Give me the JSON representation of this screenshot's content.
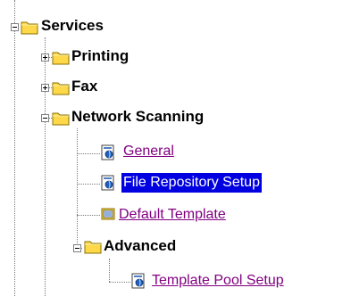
{
  "tree": {
    "services": {
      "label": "Services",
      "expanded": true,
      "icon": "folder-icon",
      "children": {
        "printing": {
          "label": "Printing",
          "expanded": false,
          "icon": "folder-icon"
        },
        "fax": {
          "label": "Fax",
          "expanded": false,
          "icon": "folder-icon"
        },
        "network_scanning": {
          "label": "Network Scanning",
          "expanded": true,
          "icon": "folder-icon",
          "children": {
            "general": {
              "label": "General",
              "icon": "document-icon"
            },
            "file_repository_setup": {
              "label": "File Repository Setup",
              "icon": "document-icon",
              "selected": true
            },
            "default_template": {
              "label": "Default Template",
              "icon": "document-list-icon"
            },
            "advanced": {
              "label": "Advanced",
              "expanded": true,
              "icon": "folder-icon",
              "children": {
                "template_pool_setup": {
                  "label": "Template Pool Setup",
                  "icon": "document-icon"
                }
              }
            }
          }
        }
      }
    }
  },
  "colors": {
    "link": "#800080",
    "selected_bg": "#0000e0",
    "selected_text": "#ffffff",
    "folder_yellow": "#ffd84a",
    "folder_dark": "#c8a000"
  }
}
